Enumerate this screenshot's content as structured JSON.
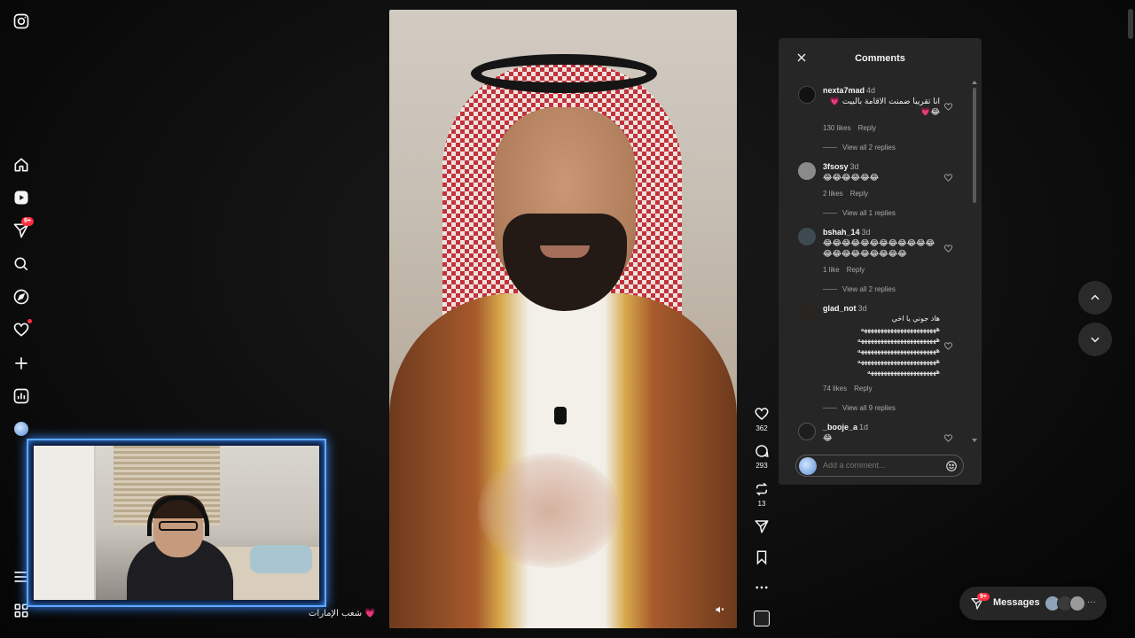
{
  "app": {
    "name": "Instagram"
  },
  "sidebar": {
    "items": [
      {
        "name": "home",
        "icon": "home-icon"
      },
      {
        "name": "reels",
        "icon": "reels-icon"
      },
      {
        "name": "messages",
        "icon": "paper-plane-icon",
        "badge": "9+"
      },
      {
        "name": "search",
        "icon": "search-icon"
      },
      {
        "name": "explore",
        "icon": "compass-icon"
      },
      {
        "name": "notifications",
        "icon": "heart-icon"
      },
      {
        "name": "create",
        "icon": "plus-icon"
      },
      {
        "name": "dashboard",
        "icon": "dashboard-icon"
      },
      {
        "name": "profile",
        "icon": "avatar"
      }
    ]
  },
  "overlay": {
    "caption": "شعب الإمارات 💗"
  },
  "reel": {
    "likes": "362",
    "comments": "293",
    "reposts": "13"
  },
  "comments_panel": {
    "title": "Comments",
    "comments": [
      {
        "user": "nexta7mad",
        "age": "4d",
        "text": "انا تقريبا ضمنت الاقامة بالبيت 💗\n😂💗",
        "likes": "130 likes",
        "reply": "Reply",
        "replies": "View all 2 replies"
      },
      {
        "user": "3fsosy",
        "age": "3d",
        "text": "😂😂😂😂😂😂",
        "likes": "2 likes",
        "reply": "Reply",
        "replies": "View all 1 replies"
      },
      {
        "user": "bshah_14",
        "age": "3d",
        "text": "😂😂😂😂😂😂😂😂😂😂😂😂😂😂😂😂😂😂😂😂😂",
        "likes": "1 like",
        "reply": "Reply",
        "replies": "View all 2 replies"
      },
      {
        "user": "glad_not",
        "age": "3d",
        "text": "هاد جوني يا اخي\nهههههههههههههههههههههههه\nههههههههههههههههههههههههه\nههههههههههههههههههههههههه\nههههههههههههههههههههههههه\nهههههههههههههههههههههه",
        "likes": "74 likes",
        "reply": "Reply",
        "replies": "View all 9 replies"
      },
      {
        "user": "_booje_a",
        "age": "1d",
        "text": "😂"
      }
    ],
    "input_placeholder": "Add a comment..."
  },
  "messages_bar": {
    "label": "Messages",
    "badge": "9+",
    "more": "···"
  },
  "colors": {
    "accent_blue": "#5fa8ff",
    "badge_red": "#ff3040",
    "panel_bg": "#262626"
  }
}
